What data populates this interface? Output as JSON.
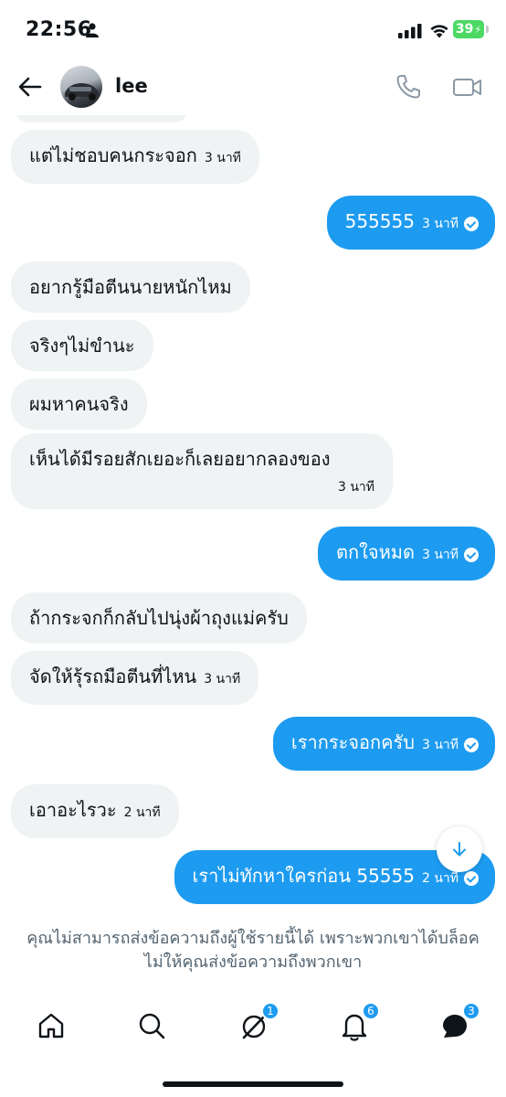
{
  "status_bar": {
    "time": "22:56",
    "battery": "39"
  },
  "header": {
    "contact_name": "lee",
    "icons": {
      "back": "back-arrow-icon",
      "call": "phone-icon",
      "video": "video-camera-icon"
    }
  },
  "messages": [
    {
      "side": "in",
      "text": "แต่ไม่ชอบคนกระจอก",
      "time": "3 นาที"
    },
    {
      "side": "out",
      "text": "555555",
      "time": "3 นาที"
    },
    {
      "side": "in",
      "text": "อยากรู้มือตีนนายหนักไหม",
      "time": ""
    },
    {
      "side": "in",
      "text": "จริงๆไม่ขำนะ",
      "time": ""
    },
    {
      "side": "in",
      "text": "ผมหาคนจริง",
      "time": ""
    },
    {
      "side": "in",
      "text": "เห็นได้มีรอยสักเยอะก็เลยอยากลองของ",
      "time": "3 นาที"
    },
    {
      "side": "out",
      "text": "ตกใจหมด",
      "time": "3 นาที"
    },
    {
      "side": "in",
      "text": "ถ้ากระจกก็กลับไปนุ่งผ้าถุงแม่ครับ",
      "time": ""
    },
    {
      "side": "in",
      "text": "จัดให้รุ้รถมือตีนที่ไหน",
      "time": "3 นาที"
    },
    {
      "side": "out",
      "text": "เรากระจอกครับ",
      "time": "3 นาที"
    },
    {
      "side": "in",
      "text": "เอาอะไรวะ",
      "time": "2 นาที"
    },
    {
      "side": "out",
      "text": "เราไม่ทักหาใครก่อน 55555",
      "time": "2 นาที"
    }
  ],
  "blocked_notice": "คุณไม่สามารถส่งข้อความถึงผู้ใช้รายนี้ได้ เพราะพวกเขาได้บล็อคไม่ให้คุณส่งข้อความถึงพวกเขา",
  "nav": {
    "home_icon": "home-icon",
    "search_icon": "search-icon",
    "grok_icon": "grok-icon",
    "grok_badge": "1",
    "notifications_icon": "bell-icon",
    "notifications_badge": "6",
    "messages_icon": "messages-icon",
    "messages_badge": "3"
  },
  "colors": {
    "accent": "#1d9bf0",
    "incoming_bubble": "#eff3f4",
    "muted_text": "#536471"
  }
}
